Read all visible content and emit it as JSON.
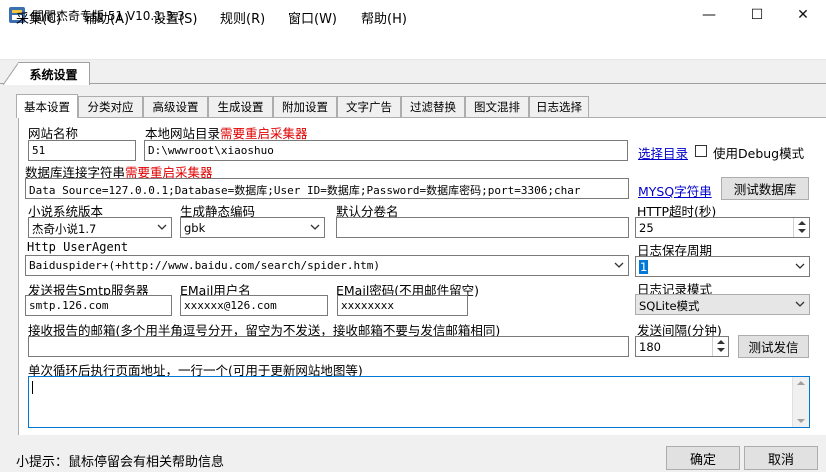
{
  "window": {
    "title": "關關杰奇专版 51 V10.1.3.3",
    "min_glyph": "—",
    "max_glyph": "☐",
    "close_glyph": "✕"
  },
  "menu": [
    "采集(C)",
    "辅助(A)",
    "设置(S)",
    "规则(R)",
    "窗口(W)",
    "帮助(H)"
  ],
  "outer_tab": "系统设置",
  "tabs": [
    "基本设置",
    "分类对应",
    "高级设置",
    "生成设置",
    "附加设置",
    "文字广告",
    "过滤替换",
    "图文混排",
    "日志选择"
  ],
  "form": {
    "site_name_label": "网站名称",
    "site_name_value": "51",
    "local_dir_label": "本地网站目录",
    "local_dir_warning": "需要重启采集器",
    "local_dir_value": "D:\\wwwroot\\xiaoshuo",
    "choose_dir_link": "选择目录",
    "debug_label": "使用Debug模式",
    "db_conn_label": "数据库连接字符串",
    "db_conn_warning": "需要重启采集器",
    "db_conn_value": "Data Source=127.0.0.1;Database=数据库;User ID=数据库;Password=数据库密码;port=3306;char",
    "mysql_link": "MYSQ字符串",
    "test_db_button": "测试数据库",
    "novel_version_label": "小说系统版本",
    "novel_version_value": "杰奇小说1.7",
    "encoding_label": "生成静态编码",
    "encoding_value": "gbk",
    "default_volume_label": "默认分卷名",
    "default_volume_value": "",
    "http_timeout_label": "HTTP超时(秒)",
    "http_timeout_value": "25",
    "useragent_label": "Http UserAgent",
    "useragent_value": "Baiduspider+(+http://www.baidu.com/search/spider.htm)",
    "log_period_label": "日志保存周期",
    "log_period_value": "1",
    "smtp_label": "发送报告Smtp服务器",
    "smtp_value": "smtp.126.com",
    "email_user_label": "EMail用户名",
    "email_user_value": "xxxxxx@126.com",
    "email_pass_label": "EMail密码(不用邮件留空)",
    "email_pass_value": "xxxxxxxx",
    "log_mode_label": "日志记录模式",
    "log_mode_value": "SQLite模式",
    "receiver_label": "接收报告的邮箱(多个用半角逗号分开，留空为不发送，接收邮箱不要与发信邮箱相同)",
    "receiver_value": "",
    "send_interval_label": "发送间隔(分钟)",
    "send_interval_value": "180",
    "test_send_button": "测试发信",
    "loop_url_label": "单次循环后执行页面地址，一行一个(可用于更新网站地图等)",
    "loop_url_value": ""
  },
  "footer": {
    "tip": "小提示：鼠标停留会有相关帮助信息",
    "ok": "确定",
    "cancel": "取消"
  },
  "colors": {
    "warning": "#e00000",
    "link": "#0000cc",
    "focus": "#0078d7"
  }
}
